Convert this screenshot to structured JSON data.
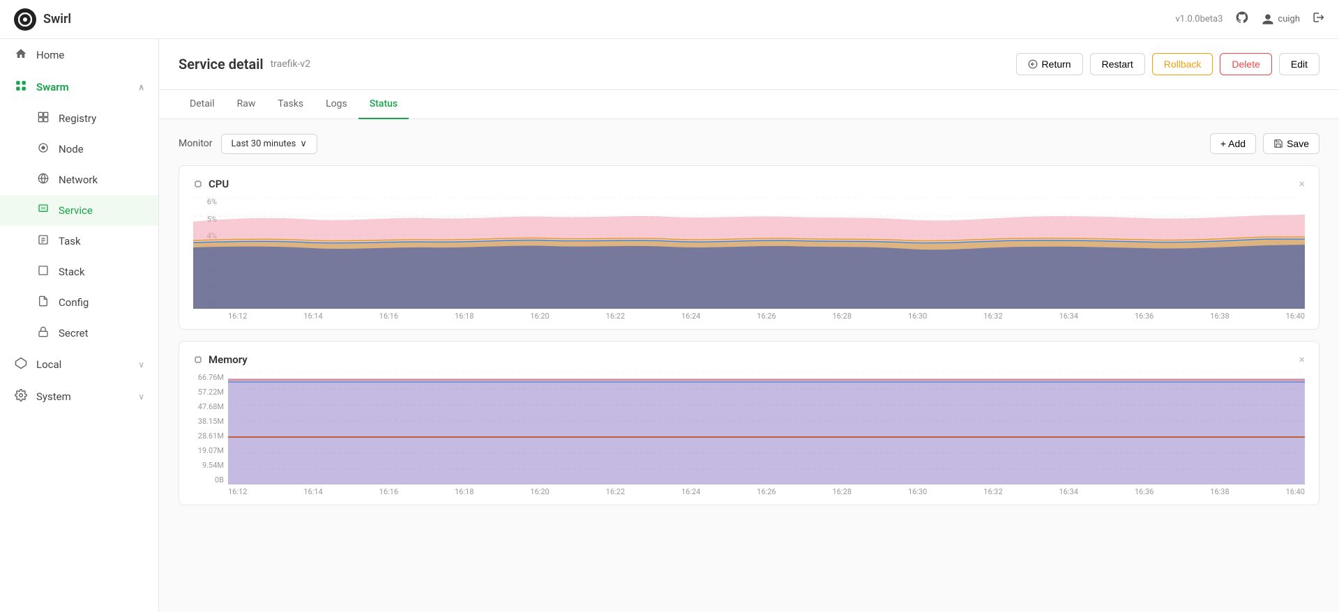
{
  "topbar": {
    "logo_text": "Swirl",
    "version": "v1.0.0beta3",
    "user": "cuigh"
  },
  "sidebar": {
    "items": [
      {
        "id": "home",
        "label": "Home",
        "icon": "🏠",
        "active": false,
        "sub": false
      },
      {
        "id": "swarm",
        "label": "Swarm",
        "icon": "⊞",
        "active": false,
        "expanded": true,
        "sub": false,
        "parent": true
      },
      {
        "id": "registry",
        "label": "Registry",
        "icon": "▦",
        "active": false,
        "sub": true
      },
      {
        "id": "node",
        "label": "Node",
        "icon": "○",
        "active": false,
        "sub": true
      },
      {
        "id": "network",
        "label": "Network",
        "icon": "⊕",
        "active": false,
        "sub": true
      },
      {
        "id": "service",
        "label": "Service",
        "icon": "🖼",
        "active": true,
        "sub": true
      },
      {
        "id": "task",
        "label": "Task",
        "icon": "🖼",
        "active": false,
        "sub": true
      },
      {
        "id": "stack",
        "label": "Stack",
        "icon": "□",
        "active": false,
        "sub": true
      },
      {
        "id": "config",
        "label": "Config",
        "icon": "📄",
        "active": false,
        "sub": true
      },
      {
        "id": "secret",
        "label": "Secret",
        "icon": "🔒",
        "active": false,
        "sub": true
      },
      {
        "id": "local",
        "label": "Local",
        "icon": "⬡",
        "active": false,
        "sub": false,
        "chevron": "∨"
      },
      {
        "id": "system",
        "label": "System",
        "icon": "⚙",
        "active": false,
        "sub": false,
        "chevron": "∨"
      }
    ]
  },
  "page": {
    "title": "Service detail",
    "subtitle": "traefik-v2",
    "actions": {
      "return": "Return",
      "restart": "Restart",
      "rollback": "Rollback",
      "delete": "Delete",
      "edit": "Edit"
    }
  },
  "tabs": [
    {
      "id": "detail",
      "label": "Detail",
      "active": false
    },
    {
      "id": "raw",
      "label": "Raw",
      "active": false
    },
    {
      "id": "tasks",
      "label": "Tasks",
      "active": false
    },
    {
      "id": "logs",
      "label": "Logs",
      "active": false
    },
    {
      "id": "status",
      "label": "Status",
      "active": true
    }
  ],
  "monitor": {
    "label": "Monitor",
    "period": "Last 30 minutes",
    "chevron": "∨",
    "add_label": "+ Add",
    "save_label": "Save"
  },
  "cpu_chart": {
    "title": "CPU",
    "y_labels": [
      "0%",
      "1%",
      "2%",
      "3%",
      "4%",
      "5%",
      "6%"
    ],
    "x_labels": [
      "16:12",
      "16:14",
      "16:16",
      "16:18",
      "16:20",
      "16:22",
      "16:24",
      "16:26",
      "16:28",
      "16:30",
      "16:32",
      "16:34",
      "16:36",
      "16:38",
      "16:40"
    ]
  },
  "memory_chart": {
    "title": "Memory",
    "y_labels": [
      "0B",
      "9.54M",
      "19.07M",
      "28.61M",
      "38.15M",
      "47.68M",
      "57.22M",
      "66.76M"
    ],
    "x_labels": [
      "16:12",
      "16:14",
      "16:16",
      "16:18",
      "16:20",
      "16:22",
      "16:24",
      "16:26",
      "16:28",
      "16:30",
      "16:32",
      "16:34",
      "16:36",
      "16:38",
      "16:40"
    ]
  },
  "colors": {
    "accent": "#16a34a",
    "rollback": "#f59e0b",
    "delete": "#ef4444",
    "active_sidebar_bg": "#f0faf0"
  }
}
